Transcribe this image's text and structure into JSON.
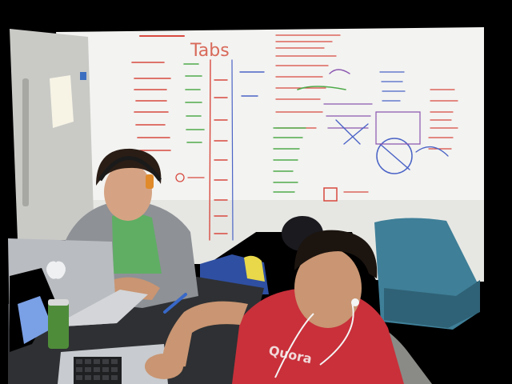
{
  "scene": {
    "colors": {
      "frame": "#000000",
      "whiteboard": "#f3f3f1",
      "wall_shadow": "#d9dad6",
      "fridge": "#c9cac6",
      "marker_red": "#d8493f",
      "marker_green": "#4faa4a",
      "marker_blue": "#4a63c6",
      "marker_purple": "#8a55b0",
      "table": "#2e3033",
      "laptop": "#b9bcc0",
      "shirt_red": "#c9303a",
      "shirt_green": "#5fae64",
      "hoodie_gray": "#8e9196",
      "chair_teal": "#3f7f98",
      "chair_gray": "#8a8b86",
      "skin": "#c99572",
      "hair": "#2a1d16"
    },
    "whiteboard_text": {
      "header_tabs": "Tabs",
      "shirt_print": "Quora"
    }
  }
}
